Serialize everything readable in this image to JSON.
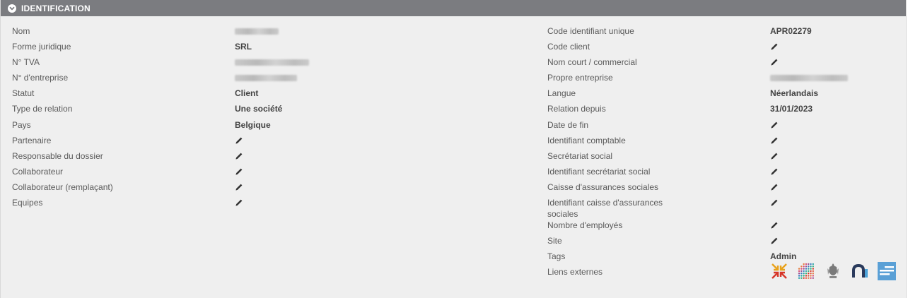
{
  "header": {
    "title": "IDENTIFICATION"
  },
  "left_fields": [
    {
      "label": "Nom",
      "value": "",
      "kind": "blurred"
    },
    {
      "label": "Forme juridique",
      "value": "SRL",
      "kind": "text"
    },
    {
      "label": "N° TVA",
      "value": "",
      "kind": "blurred"
    },
    {
      "label": "N° d'entreprise",
      "value": "",
      "kind": "blurred"
    },
    {
      "label": "Statut",
      "value": "Client",
      "kind": "text"
    },
    {
      "label": "Type de relation",
      "value": "Une société",
      "kind": "text"
    },
    {
      "label": "Pays",
      "value": "Belgique",
      "kind": "text"
    },
    {
      "label": "Partenaire",
      "value": "",
      "kind": "edit"
    },
    {
      "label": "Responsable du dossier",
      "value": "",
      "kind": "edit"
    },
    {
      "label": "Collaborateur",
      "value": "",
      "kind": "edit"
    },
    {
      "label": "Collaborateur (remplaçant)",
      "value": "",
      "kind": "edit"
    },
    {
      "label": "Equipes",
      "value": "",
      "kind": "edit"
    }
  ],
  "right_fields": [
    {
      "label": "Code identifiant unique",
      "value": "APR02279",
      "kind": "text"
    },
    {
      "label": "Code client",
      "value": "",
      "kind": "edit"
    },
    {
      "label": "Nom court / commercial",
      "value": "",
      "kind": "edit"
    },
    {
      "label": "Propre entreprise",
      "value": "",
      "kind": "blurred"
    },
    {
      "label": "Langue",
      "value": "Néerlandais",
      "kind": "text"
    },
    {
      "label": "Relation depuis",
      "value": "31/01/2023",
      "kind": "text"
    },
    {
      "label": "Date de fin",
      "value": "",
      "kind": "edit"
    },
    {
      "label": "Identifiant comptable",
      "value": "",
      "kind": "edit"
    },
    {
      "label": "Secrétariat social",
      "value": "",
      "kind": "edit"
    },
    {
      "label": "Identifiant secrétariat social",
      "value": "",
      "kind": "edit"
    },
    {
      "label": "Caisse d'assurances sociales",
      "value": "",
      "kind": "edit"
    },
    {
      "label": "Identifiant caisse d'assurances sociales",
      "value": "",
      "kind": "edit"
    },
    {
      "label": "Nombre d'employés",
      "value": "",
      "kind": "edit"
    },
    {
      "label": "Site",
      "value": "",
      "kind": "edit"
    },
    {
      "label": "Tags",
      "value": "Admin",
      "kind": "text"
    },
    {
      "label": "Liens externes",
      "value": "",
      "kind": "links"
    }
  ],
  "external_links": [
    {
      "icon": "arrows-logo-icon"
    },
    {
      "icon": "dots-grid-logo-icon"
    },
    {
      "icon": "coat-of-arms-icon"
    },
    {
      "icon": "n-logo-icon"
    },
    {
      "icon": "bars-logo-icon"
    }
  ],
  "colors": {
    "header_bg": "#7b7c80",
    "panel_bg": "#efefef",
    "label": "#5a5a5a",
    "value": "#444444"
  }
}
